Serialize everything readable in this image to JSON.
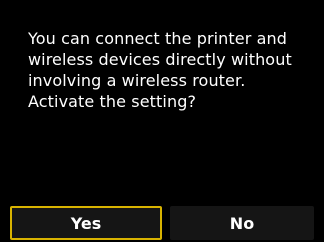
{
  "dialog": {
    "message_lines": [
      "You can connect the printer and",
      "wireless devices directly without",
      "involving a wireless router.",
      "Activate the setting?"
    ]
  },
  "buttons": {
    "yes_label": "Yes",
    "no_label": "No",
    "selected": "Yes"
  },
  "colors": {
    "background": "#000000",
    "text": "#ffffff",
    "button_fill": "#151515",
    "selection_border": "#d8b300"
  }
}
